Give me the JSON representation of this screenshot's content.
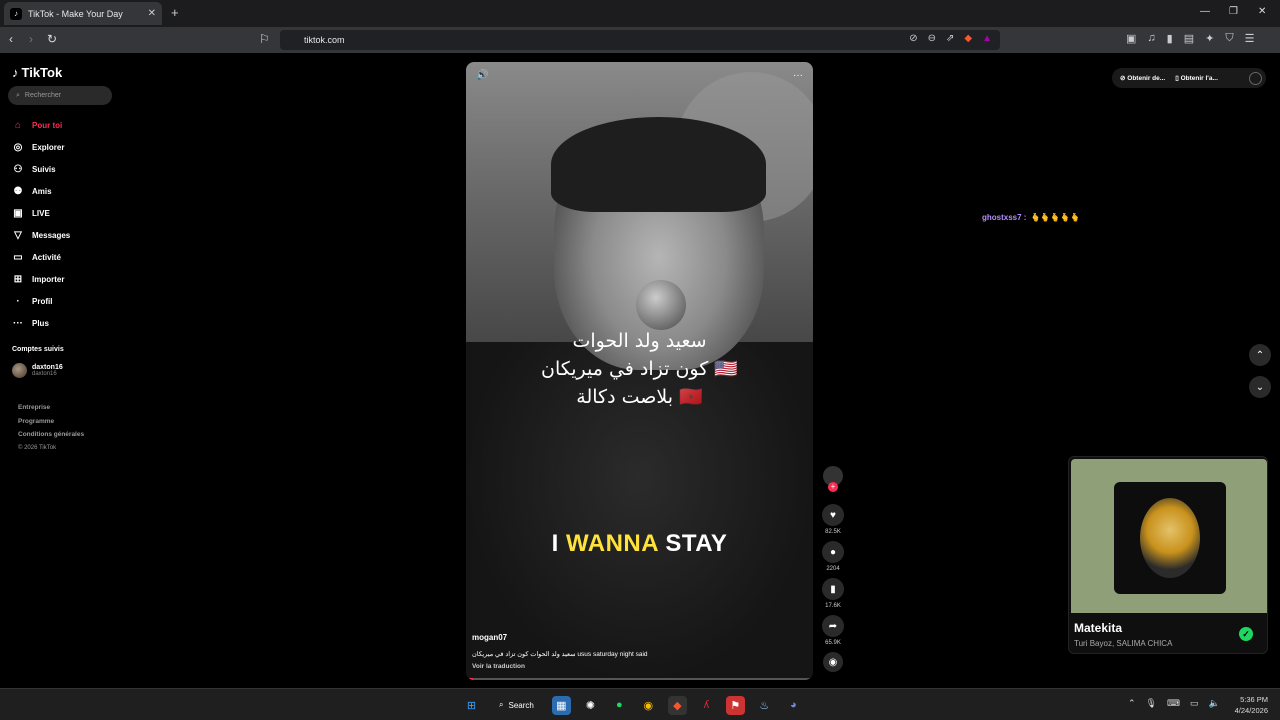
{
  "browser": {
    "tab_title": "TikTok - Make Your Day",
    "new_tab": "+",
    "url": "tiktok.com"
  },
  "sidebar": {
    "logo": "TikTok",
    "search_placeholder": "Rechercher",
    "items": [
      {
        "label": "Pour toi",
        "icon": "home-icon",
        "glyph": "⌂"
      },
      {
        "label": "Explorer",
        "icon": "compass-icon",
        "glyph": "◎"
      },
      {
        "label": "Suivis",
        "icon": "following-icon",
        "glyph": "⚇"
      },
      {
        "label": "Amis",
        "icon": "friends-icon",
        "glyph": "⚉"
      },
      {
        "label": "LIVE",
        "icon": "live-icon",
        "glyph": "▣"
      },
      {
        "label": "Messages",
        "icon": "messages-icon",
        "glyph": "▽"
      },
      {
        "label": "Activité",
        "icon": "activity-icon",
        "glyph": "▭"
      },
      {
        "label": "Importer",
        "icon": "upload-icon",
        "glyph": "⊞"
      },
      {
        "label": "Profil",
        "icon": "profile-icon",
        "glyph": "·"
      },
      {
        "label": "Plus",
        "icon": "more-icon",
        "glyph": "···"
      }
    ],
    "following_title": "Comptes suivis",
    "account_name": "daxton16",
    "account_handle": "daxton16",
    "footer": [
      "Entreprise",
      "Programme",
      "Conditions générales"
    ],
    "copyright": "© 2026 TikTok"
  },
  "video": {
    "arabic_line1": "سعيد ولد الحوات",
    "arabic_line2": "🇺🇸 كون تزاد في ميريكان",
    "arabic_line3": "🇲🇦 بلاصت دكالة",
    "caption_white1": "I ",
    "caption_yellow": "WANNA",
    "caption_white2": " STAY",
    "username": "mogan07",
    "description": "سعيد ولد الحوات كون تزاد في ميريكان usus saturday night said",
    "translate": "Voir la traduction",
    "progress": 0.02
  },
  "actions": {
    "likes": "82.5K",
    "comments": "2204",
    "saves": "17.6K",
    "shares": "65.9K"
  },
  "topright": {
    "btn1": "Obtenir de...",
    "btn2": "Obtenir l'a..."
  },
  "chat": {
    "user": "ghostxss7 :",
    "message": "🫰🫰🫰🫰🫰"
  },
  "music": {
    "title": "Matekita",
    "artist": "Turi Bayoz, SALIMA CHICA"
  },
  "taskbar": {
    "search": "Search",
    "time": "5:36 PM",
    "date": "4/24/2026"
  }
}
